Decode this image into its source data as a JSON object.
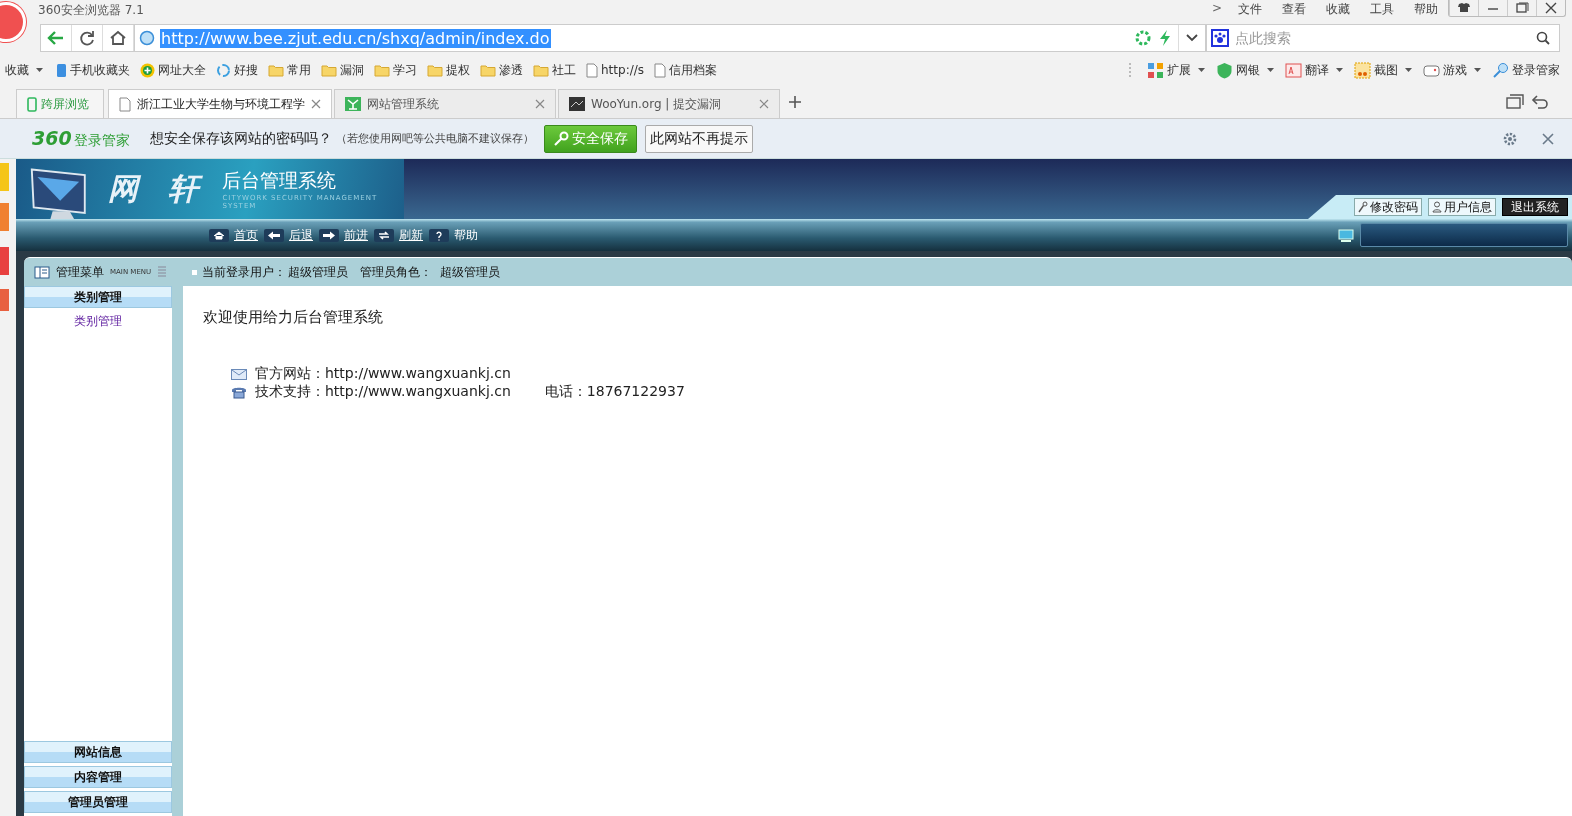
{
  "browser": {
    "title": "360安全浏览器 7.1",
    "menu_arrow": ">",
    "menu": [
      "文件",
      "查看",
      "收藏",
      "工具",
      "帮助"
    ],
    "address": "http://www.bee.zjut.edu.cn/shxq/admin/index.do",
    "search": {
      "placeholder": "点此搜索"
    },
    "bookmarks": [
      {
        "label": "收藏",
        "kind": "menu"
      },
      {
        "label": "手机收藏夹",
        "kind": "phone"
      },
      {
        "label": "网址大全",
        "kind": "site"
      },
      {
        "label": "好搜",
        "kind": "search"
      },
      {
        "label": "常用",
        "kind": "folder"
      },
      {
        "label": "漏洞",
        "kind": "folder"
      },
      {
        "label": "学习",
        "kind": "folder"
      },
      {
        "label": "提权",
        "kind": "folder"
      },
      {
        "label": "渗透",
        "kind": "folder"
      },
      {
        "label": "社工",
        "kind": "folder"
      },
      {
        "label": "http://s",
        "kind": "page"
      },
      {
        "label": "信用档案",
        "kind": "page"
      }
    ],
    "tools": [
      {
        "label": "扩展",
        "kind": "grid"
      },
      {
        "label": "网银",
        "kind": "shield"
      },
      {
        "label": "翻译",
        "kind": "translate"
      },
      {
        "label": "截图",
        "kind": "scissors"
      },
      {
        "label": "游戏",
        "kind": "gamepad"
      },
      {
        "label": "登录管家",
        "kind": "key"
      }
    ],
    "pinned_tab": "跨屏浏览",
    "tabs": [
      {
        "label": "浙江工业大学生物与环境工程学",
        "kind": "page",
        "selected": true
      },
      {
        "label": "网站管理系统",
        "kind": "site",
        "selected": false
      },
      {
        "label": "WooYun.org | 提交漏洞",
        "kind": "dark",
        "selected": false
      }
    ]
  },
  "password_bar": {
    "brand_number": "360",
    "brand": "登录管家",
    "question": "想安全保存该网站的密码吗？",
    "hint": "（若您使用网吧等公共电脑不建议保存）",
    "save_button": "安全保存",
    "never_button": "此网站不再提示"
  },
  "admin": {
    "logo_chars": [
      "网",
      "轩"
    ],
    "title": "后台管理系统",
    "subtitle": "CITYWORK SECURITY MANAGEMENT SYSTEM",
    "account_buttons": [
      {
        "label": "修改密码",
        "kind": "key"
      },
      {
        "label": "用户信息",
        "kind": "user"
      },
      {
        "label": "退出系统",
        "kind": "exit"
      }
    ],
    "nav": [
      {
        "label": "首页",
        "kind": "home",
        "underlined": true
      },
      {
        "label": "后退",
        "kind": "back",
        "underlined": true
      },
      {
        "label": "前进",
        "kind": "forward",
        "underlined": true
      },
      {
        "label": "刷新",
        "kind": "refresh",
        "underlined": true
      },
      {
        "label": "帮助",
        "kind": "help",
        "underlined": false
      }
    ],
    "menu": {
      "title": "管理菜单",
      "subtitle": "MAIN MENU",
      "open_section": {
        "title": "类别管理",
        "items": [
          "类别管理"
        ]
      },
      "closed_sections": [
        "网站信息",
        "内容管理",
        "管理员管理"
      ]
    },
    "status": {
      "user_label": "当前登录用户：",
      "user": "超级管理员",
      "role_label": "管理员角色：",
      "role": "超级管理员"
    },
    "welcome": "欢迎使用给力后台管理系统",
    "contacts": [
      {
        "kind": "mail",
        "label": "官方网站：",
        "value": "http://www.wangxuankj.cn"
      },
      {
        "kind": "phone",
        "label": "技术支持：",
        "value": "http://www.wangxuankj.cn",
        "extra": "电话：18767122937"
      }
    ]
  }
}
